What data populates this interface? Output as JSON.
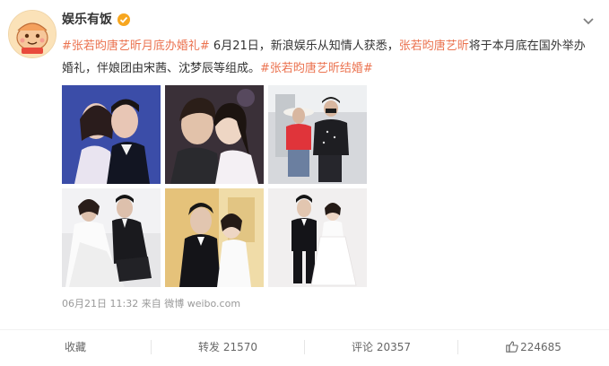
{
  "post": {
    "author": "娱乐有饭",
    "text": {
      "tag1": "#张若昀唐艺昕月底办婚礼#",
      "body1": " 6月21日，新浪娱乐从知情人获悉，",
      "mention": "张若昀唐艺昕",
      "body2": "将于本月底在国外举办婚礼，伴娘团由宋茜、沈梦辰等组成。",
      "tag2": "#张若昀唐艺昕结婚#"
    },
    "timestamp": "06月21日 11:32",
    "source_prefix": "来自",
    "source": "微博 weibo.com",
    "photos": [
      {
        "name": "couple-night-portrait"
      },
      {
        "name": "couple-kiss-selfie"
      },
      {
        "name": "couple-airport"
      },
      {
        "name": "wedding-sofa"
      },
      {
        "name": "wedding-gold-backdrop"
      },
      {
        "name": "wedding-standing-couple"
      }
    ]
  },
  "footer": {
    "favorite_label": "收藏",
    "repost_label": "转发",
    "repost_count": "21570",
    "comment_label": "评论",
    "comment_count": "20357",
    "like_count": "224685"
  },
  "colors": {
    "accent": "#eb7350",
    "verified": "#f7a61f",
    "muted": "#999999"
  },
  "icons": [
    "verified-badge-icon",
    "chevron-down-icon",
    "thumbs-up-icon"
  ]
}
